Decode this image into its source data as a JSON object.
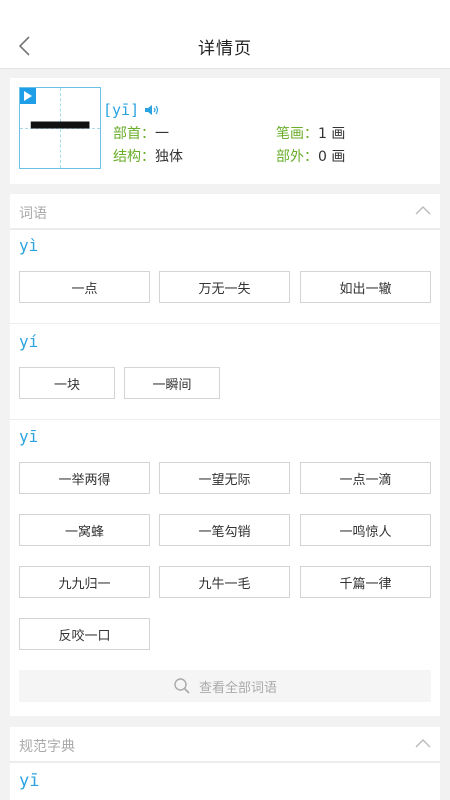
{
  "header": {
    "title": "详情页"
  },
  "character": {
    "glyph": "一",
    "pinyin": "[yī]",
    "radical_label": "部首：",
    "radical_value": "一",
    "strokes_label": "笔画：",
    "strokes_value": "1 画",
    "structure_label": "结构：",
    "structure_value": "独体",
    "extra_strokes_label": "部外：",
    "extra_strokes_value": "0 画"
  },
  "words_section": {
    "title": "词语",
    "groups": [
      {
        "pinyin": "yì",
        "words": [
          "一点",
          "万无一失",
          "如出一辙"
        ]
      },
      {
        "pinyin": "yí",
        "words": [
          "一块",
          "一瞬间"
        ]
      },
      {
        "pinyin": "yī",
        "words": [
          "一举两得",
          "一望无际",
          "一点一滴",
          "一窝蜂",
          "一笔勾销",
          "一鸣惊人",
          "九九归一",
          "九牛一毛",
          "千篇一律",
          "反咬一口"
        ]
      }
    ],
    "view_all_label": "查看全部词语"
  },
  "dictionary_section": {
    "title": "规范字典",
    "pinyin": "yī"
  },
  "colors": {
    "accent_blue": "#2aa3e0",
    "label_green": "#6aae2a"
  }
}
